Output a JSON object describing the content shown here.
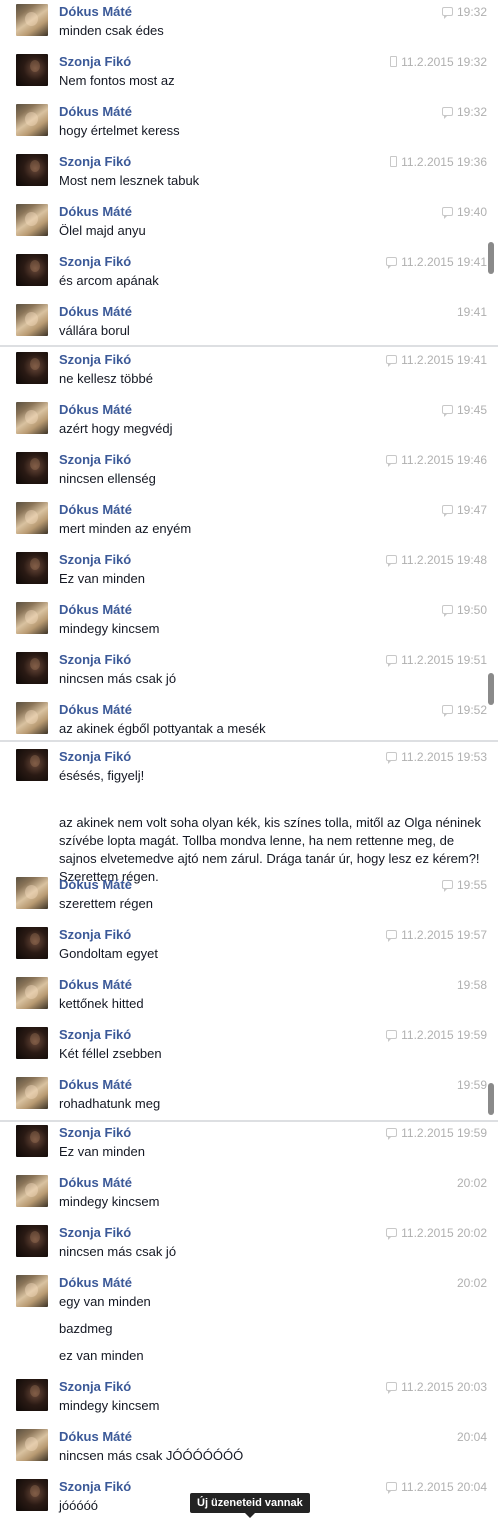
{
  "senders": {
    "dokus": "Dókus Máté",
    "szonja": "Szonja Fikó"
  },
  "messages": [
    {
      "sender": "dokus",
      "time": "19:32",
      "icon": "chat-icon",
      "lines": [
        "minden csak édes"
      ]
    },
    {
      "sender": "szonja",
      "time": "11.2.2015 19:32",
      "icon": "phone-icon",
      "lines": [
        "Nem fontos most az"
      ]
    },
    {
      "sender": "dokus",
      "time": "19:32",
      "icon": "chat-icon",
      "lines": [
        "hogy értelmet keress"
      ]
    },
    {
      "sender": "szonja",
      "time": "11.2.2015 19:36",
      "icon": "phone-icon",
      "lines": [
        "Most nem lesznek tabuk"
      ]
    },
    {
      "sender": "dokus",
      "time": "19:40",
      "icon": "chat-icon",
      "lines": [
        "Ölel majd anyu"
      ]
    },
    {
      "sender": "szonja",
      "time": "11.2.2015 19:41",
      "icon": "chat-icon",
      "lines": [
        "és arcom apának"
      ]
    },
    {
      "sender": "dokus",
      "time": "19:41",
      "icon": "",
      "lines": [
        "vállára borul"
      ]
    },
    {
      "sender": "szonja",
      "time": "11.2.2015 19:41",
      "icon": "chat-icon",
      "lines": [
        "ne kellesz többé"
      ]
    },
    {
      "sender": "dokus",
      "time": "19:45",
      "icon": "chat-icon",
      "lines": [
        "azért hogy megvédj"
      ]
    },
    {
      "sender": "szonja",
      "time": "11.2.2015 19:46",
      "icon": "chat-icon",
      "lines": [
        "nincsen ellenség"
      ]
    },
    {
      "sender": "dokus",
      "time": "19:47",
      "icon": "chat-icon",
      "lines": [
        "mert minden az enyém"
      ]
    },
    {
      "sender": "szonja",
      "time": "11.2.2015 19:48",
      "icon": "chat-icon",
      "lines": [
        "Ez van minden"
      ]
    },
    {
      "sender": "dokus",
      "time": "19:50",
      "icon": "chat-icon",
      "lines": [
        "mindegy kincsem"
      ]
    },
    {
      "sender": "szonja",
      "time": "11.2.2015 19:51",
      "icon": "chat-icon",
      "lines": [
        "nincsen más csak jó"
      ]
    },
    {
      "sender": "dokus",
      "time": "19:52",
      "icon": "chat-icon",
      "lines": [
        "az akinek égből pottyantak a mesék"
      ]
    },
    {
      "sender": "szonja",
      "time": "11.2.2015 19:53",
      "icon": "chat-icon",
      "lines": [
        "ésésés, figyelj!",
        "az akinek nem volt soha olyan kék, kis színes tolla, mitől az Olga néninek szívébe lopta magát. Tollba mondva lenne, ha nem rettenne meg, de sajnos elvetemedve ajtó nem zárul. Drága tanár úr, hogy lesz ez kérem?! Szerettem régen."
      ]
    },
    {
      "sender": "dokus",
      "time": "19:55",
      "icon": "chat-icon",
      "lines": [
        "szerettem régen"
      ]
    },
    {
      "sender": "szonja",
      "time": "11.2.2015 19:57",
      "icon": "chat-icon",
      "lines": [
        "Gondoltam egyet"
      ]
    },
    {
      "sender": "dokus",
      "time": "19:58",
      "icon": "",
      "lines": [
        "kettőnek hitted"
      ]
    },
    {
      "sender": "szonja",
      "time": "11.2.2015 19:59",
      "icon": "chat-icon",
      "lines": [
        "Két féllel zsebben"
      ]
    },
    {
      "sender": "dokus",
      "time": "19:59",
      "icon": "",
      "lines": [
        "rohadhatunk meg"
      ]
    },
    {
      "sender": "szonja",
      "time": "11.2.2015 19:59",
      "icon": "chat-icon",
      "lines": [
        "Ez van minden"
      ]
    },
    {
      "sender": "dokus",
      "time": "20:02",
      "icon": "",
      "lines": [
        "mindegy kincsem"
      ]
    },
    {
      "sender": "szonja",
      "time": "11.2.2015 20:02",
      "icon": "chat-icon",
      "lines": [
        "nincsen más csak jó"
      ]
    },
    {
      "sender": "dokus",
      "time": "20:02",
      "icon": "",
      "lines": [
        "egy van minden",
        "bazdmeg",
        "ez van minden"
      ]
    },
    {
      "sender": "szonja",
      "time": "11.2.2015 20:03",
      "icon": "chat-icon",
      "lines": [
        "mindegy kincsem"
      ]
    },
    {
      "sender": "dokus",
      "time": "20:04",
      "icon": "",
      "lines": [
        "nincsen más csak JÓÓÓÓÓÓÓ"
      ]
    },
    {
      "sender": "szonja",
      "time": "11.2.2015 20:04",
      "icon": "chat-icon",
      "lines": [
        "jóóóóó"
      ]
    }
  ],
  "tooltip": {
    "new_messages": "Új üzeneteid vannak"
  },
  "colors": {
    "sender_name": "#3b5998",
    "timestamp": "#b0b0b0",
    "tooltip_bg": "#232323"
  }
}
